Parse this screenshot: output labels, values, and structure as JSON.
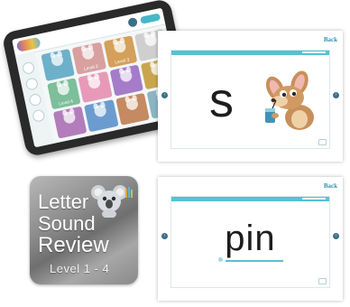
{
  "tablet": {
    "tiles": [
      {
        "label": "",
        "color": "#6db0c9"
      },
      {
        "label": "Level 2",
        "color": "#d9a0a0"
      },
      {
        "label": "Level 3",
        "color": "#d4a05a"
      },
      {
        "label": "",
        "color": "#cfcfcf"
      },
      {
        "label": "Level 4",
        "color": "#7cbf9a"
      },
      {
        "label": "",
        "color": "#e79ab8"
      },
      {
        "label": "",
        "color": "#a57cc9"
      },
      {
        "label": "",
        "color": "#c9a64e"
      },
      {
        "label": "",
        "color": "#b27dba"
      },
      {
        "label": "",
        "color": "#6c9ccf"
      },
      {
        "label": "",
        "color": "#c58a62"
      },
      {
        "label": "",
        "color": "#8bb5c4"
      }
    ]
  },
  "card_letter": {
    "back_label": "Back",
    "letter": "s"
  },
  "card_word": {
    "back_label": "Back",
    "word": "pin"
  },
  "badge": {
    "line1": "Letter",
    "line2": "Sound",
    "line3": "Review",
    "level_range": "Level 1 - 4"
  },
  "colors": {
    "accent": "#55c2d3",
    "back_link": "#2c8fb5",
    "nav": "#3b6f86"
  }
}
